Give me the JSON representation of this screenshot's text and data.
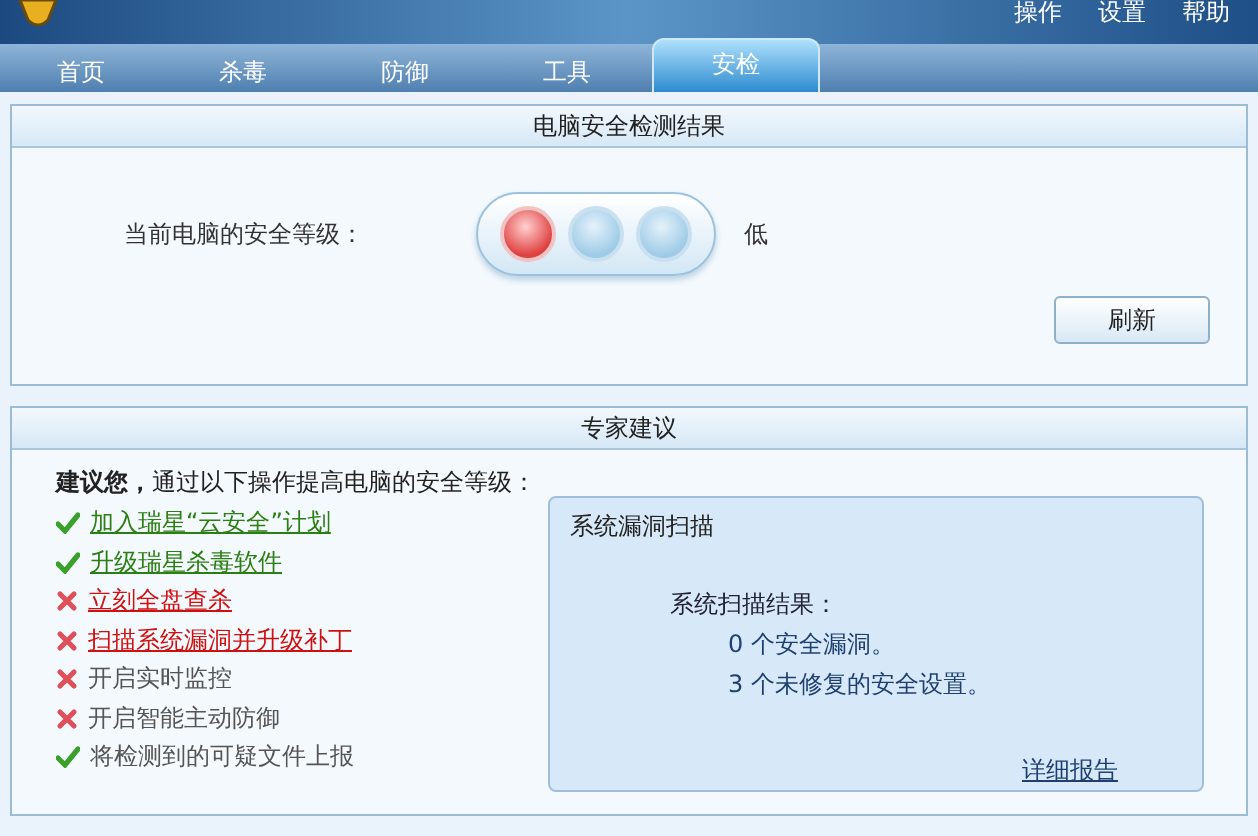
{
  "menu": [
    "操作",
    "设置",
    "帮助"
  ],
  "tabs": [
    {
      "label": "首页",
      "selected": false
    },
    {
      "label": "杀毒",
      "selected": false
    },
    {
      "label": "防御",
      "selected": false
    },
    {
      "label": "工具",
      "selected": false
    },
    {
      "label": "安检",
      "selected": true
    }
  ],
  "check_panel": {
    "title": "电脑安全检测结果",
    "label": "当前电脑的安全等级：",
    "lights": [
      {
        "on": true
      },
      {
        "on": false
      },
      {
        "on": false
      }
    ],
    "level_text": "低",
    "refresh_button": "刷新"
  },
  "advice_panel": {
    "title": "专家建议",
    "intro": "**建议您，**通过以下操作提高电脑的安全等级：",
    "items": [
      {
        "text": "加入瑞星“云安全”计划",
        "done": true,
        "link": true
      },
      {
        "text": "升级瑞星杀毒软件",
        "done": true,
        "link": true
      },
      {
        "text": "立刻全盘查杀",
        "done": false,
        "link": true
      },
      {
        "text": "扫描系统漏洞并升级补丁",
        "done": false,
        "link": true
      },
      {
        "text": "开启实时监控",
        "done": false,
        "link": false
      },
      {
        "text": "开启智能主动防御",
        "done": false,
        "link": false
      },
      {
        "text": "将检测到的可疑文件上报",
        "done": true,
        "link": false
      }
    ],
    "scan_box": {
      "title": "系统漏洞扫描",
      "result_label": "系统扫描结果：",
      "lines": [
        "0 个安全漏洞。",
        "3 个未修复的安全设置。"
      ],
      "report_link": "详细报告"
    }
  }
}
